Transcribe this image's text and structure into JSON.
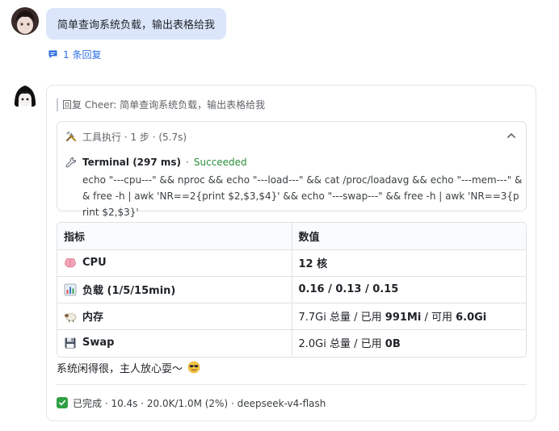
{
  "user_message": {
    "text": "简单查询系统负载，输出表格给我",
    "reply_count": "1 条回复"
  },
  "bot_reply": {
    "quote": "回复 Cheer: 简单查询系统负载，输出表格给我",
    "tool_exec": {
      "header": "工具执行 · 1 步 · (5.7s)",
      "tool_name": "Terminal (297 ms)",
      "separator": "·",
      "status": "Succeeded",
      "command": "echo \"---cpu---\" && nproc && echo \"---load---\" && cat /proc/loadavg && echo \"---mem---\" && free -h | awk 'NR==2{print $2,$3,$4}' && echo \"---swap---\" && free -h | awk 'NR==3{print $2,$3}'"
    },
    "table": {
      "headers": [
        "指标",
        "数值"
      ],
      "rows": [
        {
          "icon": "brain-icon",
          "metric": "CPU",
          "value_parts": [
            {
              "t": "12 核",
              "b": true
            }
          ]
        },
        {
          "icon": "bar-chart-icon",
          "metric": "负载 (1/5/15min)",
          "value_parts": [
            {
              "t": "0.16 / 0.13 / 0.15",
              "b": true
            }
          ]
        },
        {
          "icon": "sheep-icon",
          "metric": "内存",
          "value_parts": [
            {
              "t": "7.7Gi 总量 / 已用 ",
              "b": false
            },
            {
              "t": "991Mi",
              "b": true
            },
            {
              "t": " / 可用 ",
              "b": false
            },
            {
              "t": "6.0Gi",
              "b": true
            }
          ]
        },
        {
          "icon": "floppy-disk-icon",
          "metric": "Swap",
          "value_parts": [
            {
              "t": "2.0Gi 总量 / 已用 ",
              "b": false
            },
            {
              "t": "0B",
              "b": true
            }
          ]
        }
      ]
    },
    "summary": "系统闲得很，主人放心耍～",
    "footer": "已完成 · 10.4s · 20.0K/1.0M (2%) · deepseek-v4-flash"
  },
  "colors": {
    "accent": "#2f6fe4",
    "bubble": "#dbe6fb",
    "success": "#2ea043"
  }
}
